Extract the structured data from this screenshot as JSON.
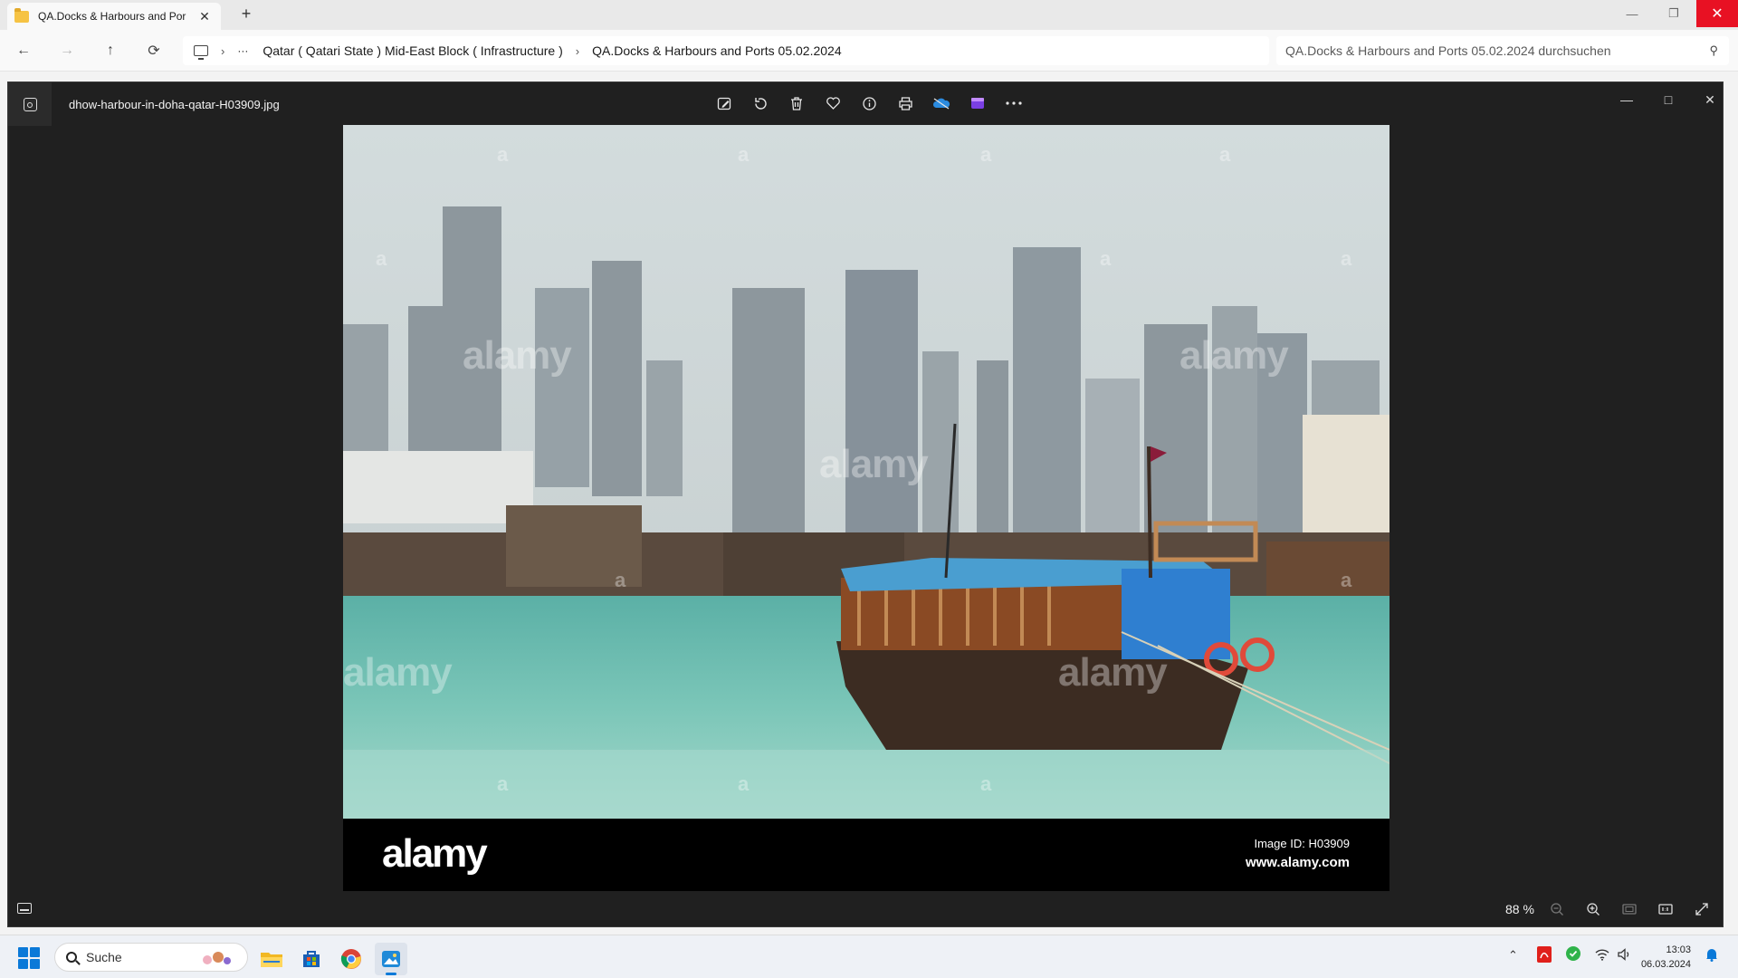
{
  "explorer": {
    "tab_title": "QA.Docks & Harbours and Por",
    "tab_close": "✕",
    "new_tab": "+",
    "breadcrumb": {
      "ellipsis": "···",
      "items": [
        "Qatar ( Qatari State ) Mid-East Block ( Infrastructure )",
        "QA.Docks & Harbours and Ports 05.02.2024"
      ]
    },
    "search_placeholder": "QA.Docks & Harbours and Ports 05.02.2024 durchsuchen"
  },
  "photos": {
    "filename": "dhow-harbour-in-doha-qatar-H03909.jpg",
    "toolbar": [
      "edit-icon",
      "rotate-icon",
      "delete-icon",
      "favorite-icon",
      "info-icon",
      "print-icon",
      "onedrive-icon",
      "clipchamp-icon",
      "more-icon"
    ],
    "image": {
      "watermark": "alamy",
      "watermark_letter": "a",
      "banner_logo": "alamy",
      "image_id": "Image ID: H03909",
      "site": "www.alamy.com"
    },
    "zoom": "88 %"
  },
  "taskbar": {
    "search_label": "Suche",
    "apps": [
      "file-explorer",
      "microsoft-store",
      "chrome",
      "photos"
    ],
    "clock_time": "13:03",
    "clock_date": "06.03.2024"
  },
  "colors": {
    "close_red": "#e81123",
    "accent": "#0a79d8",
    "viewer_bg": "#202020"
  }
}
